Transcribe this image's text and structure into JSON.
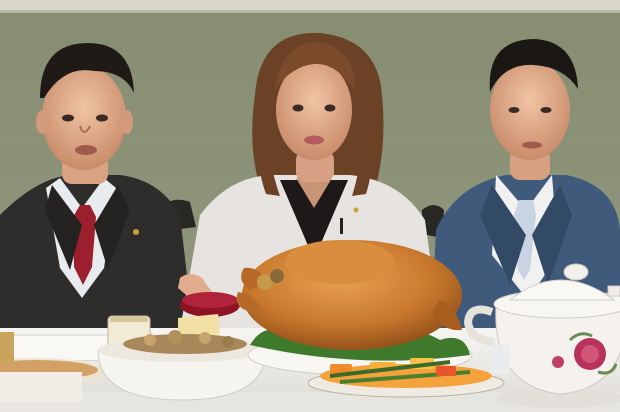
{
  "image": {
    "kind": "photo-composite",
    "description_elements": [
      "left-man-dark-suit-red-tie",
      "center-woman-white-jacket",
      "right-man-blue-suit-light-tie",
      "roast-turkey-platter",
      "stuffing-bowl",
      "cranberry-sauce-dish",
      "vegetable-platter",
      "white-soup-tureen",
      "pie-plate",
      "butter-dish"
    ],
    "colors": {
      "wall": "#8c9276",
      "ceiling_trim": "#d9d7cb",
      "tablecloth": "#f1efea",
      "left_suit": "#2e2d2b",
      "left_tie": "#9c1f2e",
      "center_jacket": "#e7e3e0",
      "center_hair": "#6b4226",
      "right_suit": "#3f5a7a",
      "right_tie": "#c9d4e3",
      "turkey": "#c8782c",
      "cranberry": "#8f1423",
      "tureen": "#f4f1ee",
      "rose_pattern": "#b8335b"
    }
  }
}
